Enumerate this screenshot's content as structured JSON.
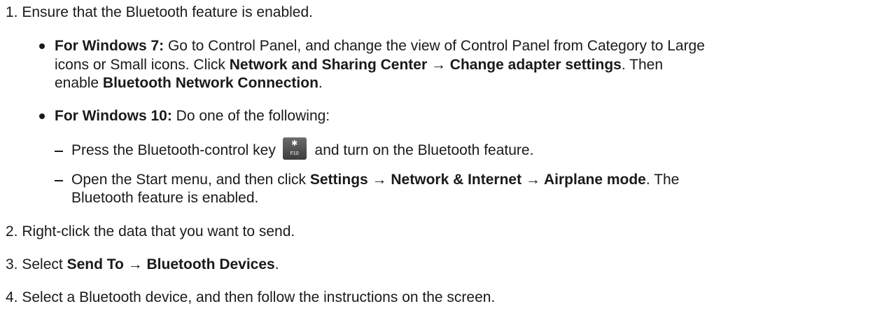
{
  "steps": {
    "s1": {
      "num": "1.",
      "text": "Ensure that the Bluetooth feature is enabled."
    },
    "win7": {
      "label": "For Windows 7:",
      "l1": " Go to Control Panel, and change the view of Control Panel from Category to Large",
      "l2a": "icons or Small icons.  Click ",
      "l2b": "Network and Sharing Center",
      "l2c": " → ",
      "l2d": "Change adapter settings",
      "l2e": ".  Then",
      "l3a": "enable ",
      "l3b": "Bluetooth Network Connection",
      "l3c": "."
    },
    "win10": {
      "label": "For Windows 10:",
      "text": " Do one of the following:",
      "sub1a": "Press the Bluetooth-control key",
      "key_symbol": "✱",
      "key_label": "F10",
      "sub1b": "and turn on the Bluetooth feature.",
      "sub2a": "Open the Start menu, and then click ",
      "sub2b": "Settings",
      "sub2c": " → ",
      "sub2d": "Network & Internet",
      "sub2e": " → ",
      "sub2f": "Airplane mode",
      "sub2g": ".  The",
      "sub2l2": "Bluetooth feature is enabled."
    },
    "s2": {
      "num": "2.",
      "text": "Right-click the data that you want to send."
    },
    "s3": {
      "num": "3.",
      "a": "Select ",
      "b": "Send To",
      "c": " → ",
      "d": "Bluetooth Devices",
      "e": "."
    },
    "s4": {
      "num": "4.",
      "text": "Select a Bluetooth device, and then follow the instructions on the screen."
    }
  }
}
